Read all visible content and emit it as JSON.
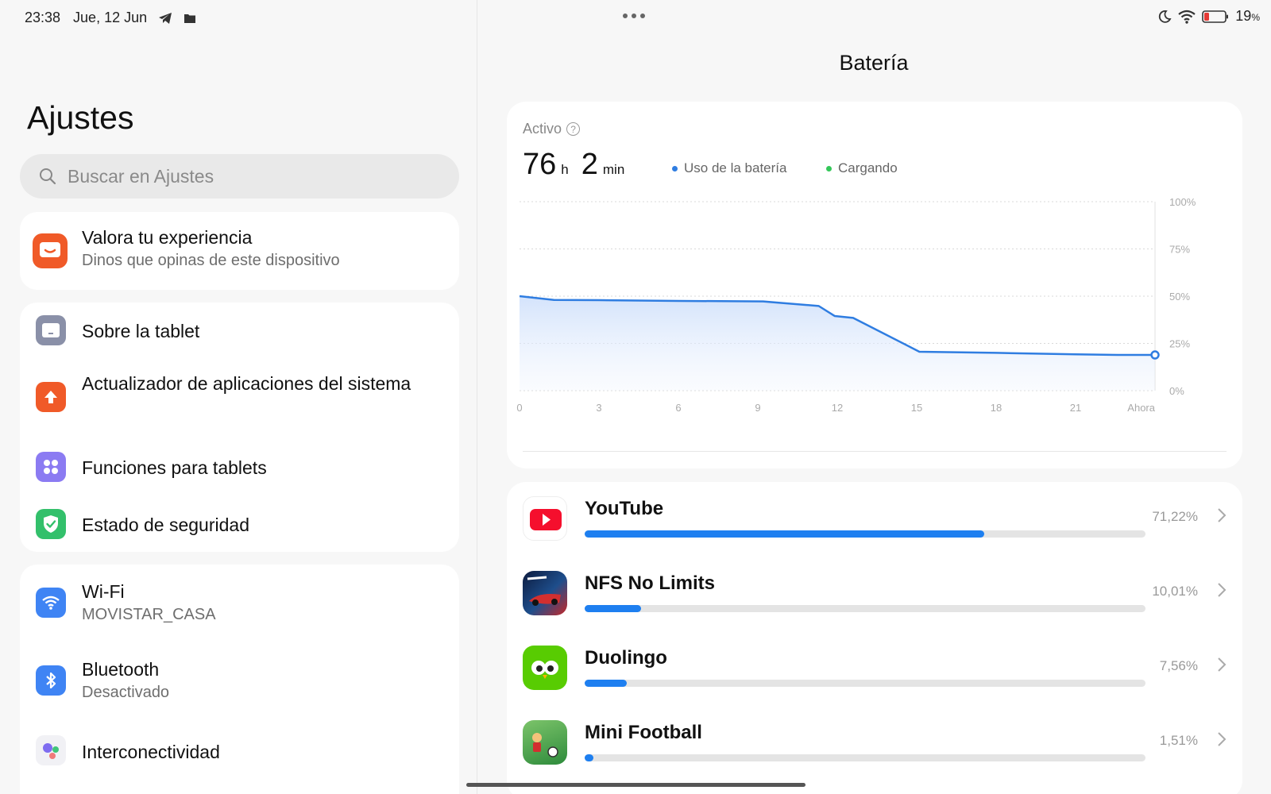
{
  "status_bar": {
    "time": "23:38",
    "date": "Jue, 12 Jun",
    "battery_pct": "19",
    "battery_unit": "%",
    "icons_left": [
      "telegram-icon",
      "folder-icon"
    ],
    "icons_right": [
      "moon-icon",
      "wifi-icon",
      "battery-icon"
    ]
  },
  "left": {
    "title": "Ajustes",
    "search_placeholder": "Buscar en Ajustes",
    "feedback": {
      "title": "Valora tu experiencia",
      "subtitle": "Dinos que opinas de este dispositivo",
      "icon": "feedback-icon",
      "color": "#f05a28"
    },
    "group1": [
      {
        "title": "Sobre la tablet",
        "icon": "tablet-icon",
        "color": "#8a90a8"
      },
      {
        "title": "Actualizador de aplicaciones del sistema",
        "icon": "update-arrow-icon",
        "color": "#f05a28"
      },
      {
        "title": "Funciones para tablets",
        "icon": "grid-dots-icon",
        "color": "#8b7bf2"
      },
      {
        "title": "Estado de seguridad",
        "icon": "shield-check-icon",
        "color": "#33c06b"
      }
    ],
    "group2": [
      {
        "title": "Wi-Fi",
        "subtitle": "MOVISTAR_CASA",
        "icon": "wifi-icon",
        "color": "#3f84f4"
      },
      {
        "title": "Bluetooth",
        "subtitle": "Desactivado",
        "icon": "bluetooth-icon",
        "color": "#3f84f4"
      },
      {
        "title": "Interconectividad",
        "icon": "interconnect-icon",
        "color": "#e8e8ee"
      }
    ]
  },
  "right": {
    "title": "Batería",
    "activo_label": "Activo",
    "duration": {
      "hours": "76",
      "h_unit": "h",
      "minutes": "2",
      "m_unit": "min"
    },
    "legend": [
      {
        "label": "Uso de la batería",
        "color": "#2f7de1"
      },
      {
        "label": "Cargando",
        "color": "#34c759"
      }
    ],
    "apps": [
      {
        "name": "YouTube",
        "percent_text": "71,22%",
        "percent": 71.22,
        "icon": "youtube-icon"
      },
      {
        "name": "NFS No Limits",
        "percent_text": "10,01%",
        "percent": 10.01,
        "icon": "nfs-game-icon"
      },
      {
        "name": "Duolingo",
        "percent_text": "7,56%",
        "percent": 7.56,
        "icon": "duolingo-owl-icon"
      },
      {
        "name": "Mini Football",
        "percent_text": "1,51%",
        "percent": 1.51,
        "icon": "mini-football-icon"
      }
    ]
  },
  "chart_data": {
    "type": "area",
    "x_ticks": [
      "0",
      "3",
      "6",
      "9",
      "12",
      "15",
      "18",
      "21",
      "Ahora"
    ],
    "y_ticks": [
      "100%",
      "75%",
      "50%",
      "25%",
      "0%"
    ],
    "ylim": [
      0,
      100
    ],
    "xlim": [
      0,
      24
    ],
    "series": [
      {
        "name": "Uso de la batería",
        "x": [
          0,
          1.3,
          3,
          6,
          9.2,
          11.3,
          11.9,
          12.6,
          15.1,
          18,
          21,
          22.6,
          24
        ],
        "y": [
          50,
          48,
          47.9,
          47.5,
          47.2,
          44.8,
          39.5,
          38.5,
          20.6,
          20,
          19.2,
          18.9,
          18.9
        ]
      }
    ],
    "grid": true,
    "legend_position": "top"
  }
}
